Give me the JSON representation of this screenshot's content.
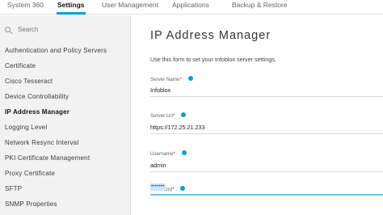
{
  "topnav": {
    "tabs": [
      "System 360",
      "Settings",
      "User Management",
      "Applications",
      "Backup & Restore"
    ],
    "active": "Settings"
  },
  "sidebar": {
    "search_label": "Search",
    "items": [
      "Authentication and Policy Servers",
      "Certificate",
      "Cisco Tesseract",
      "Device Controllability",
      "IP Address Manager",
      "Logging Level",
      "Network Resync Interval",
      "PKI Certificate Management",
      "Proxy Certificate",
      "SFTP",
      "SNMP Properties"
    ],
    "active": "IP Address Manager"
  },
  "main": {
    "title": "IP Address Manager",
    "description": "Use this form to set your Infoblox server settings.",
    "fields": [
      {
        "label": "Server Name",
        "required_mark": "*",
        "value": "Infoblox"
      },
      {
        "label": "Server Url",
        "required_mark": "*",
        "value": "https://172.25.21.233"
      },
      {
        "label": "Username",
        "required_mark": "*",
        "value": "admin"
      },
      {
        "label": "Password",
        "required_mark": "*",
        "value": "•••••••"
      }
    ]
  },
  "colors": {
    "accent": "#049fd9",
    "required": "#e2231a",
    "sidebar_bg": "#f2f2f2",
    "focus_line": "#6cc1ec"
  },
  "icons": {
    "search": "search-icon",
    "field_info": "info-icon"
  }
}
